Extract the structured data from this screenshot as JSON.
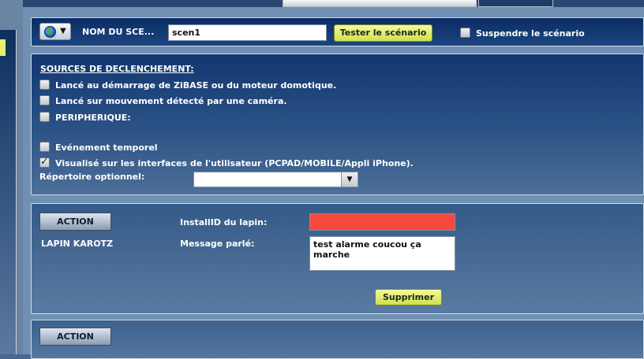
{
  "header": {
    "scene_name_label": "NOM DU SCE...",
    "scene_name_value": "scen1",
    "test_button_label": "Tester le scénario",
    "suspend_label": "Suspendre le scénario",
    "suspend_checked": false
  },
  "sources": {
    "title": "SOURCES DE DECLENCHEMENT:",
    "startup_label": "Lancé au démarrage de ZiBASE ou du moteur domotique.",
    "camera_label": "Lancé sur mouvement détecté par une caméra.",
    "device_label": "PERIPHERIQUE:",
    "timer_label": "Evénement temporel",
    "visible_label": "Visualisé sur les interfaces de l'utilisateur (PCPAD/MOBILE/Appli iPhone).",
    "visible_checked": true,
    "directory_label": "Répertoire optionnel:",
    "directory_value": ""
  },
  "actions": [
    {
      "button_label": "ACTION",
      "type_label": "LAPIN KAROTZ",
      "installid_label": "InstallID du lapin:",
      "installid_value": "",
      "message_label": "Message parlé:",
      "message_value": "test alarme coucou ça marche",
      "delete_label": "Supprimer"
    },
    {
      "button_label": "ACTION"
    }
  ],
  "colors": {
    "error_field": "#f8473c",
    "green_button": "#dceb6a"
  },
  "icons": {
    "menu": "globe-icon",
    "dropdown": "chevron-down-icon"
  }
}
